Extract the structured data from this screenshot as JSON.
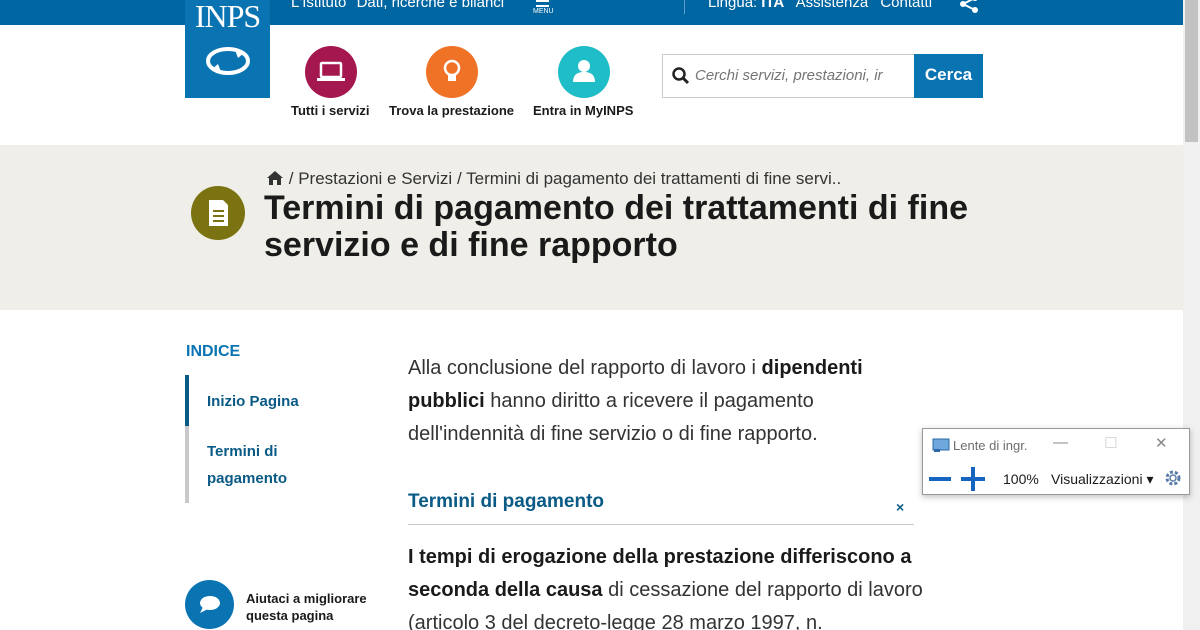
{
  "topbar": {
    "link_istituto": "L'Istituto",
    "link_dati": "Dati, ricerche e bilanci",
    "menu_label": "MENU",
    "lingua_label": "Lingua:",
    "lingua_value": "ITA",
    "link_assistenza": "Assistenza",
    "link_contatti": "Contatti"
  },
  "logo": {
    "text": "INPS"
  },
  "header": {
    "services": [
      {
        "label": "Tutti i servizi",
        "icon": "laptop-icon",
        "color": "#a4174f"
      },
      {
        "label": "Trova la prestazione",
        "icon": "lightbulb-icon",
        "color": "#f07227"
      },
      {
        "label": "Entra in MyINPS",
        "icon": "user-icon",
        "color": "#1ebdc8"
      }
    ],
    "search_placeholder": "Cerchi servizi, prestazioni, ir",
    "search_button": "Cerca"
  },
  "breadcrumb": {
    "separator": "/",
    "items": [
      "Prestazioni e Servizi",
      "Termini di pagamento dei trattamenti di fine servi.."
    ]
  },
  "page": {
    "title": "Termini di pagamento dei trattamenti di fine servizio e di fine rapporto",
    "badge_icon": "document-icon",
    "badge_color": "#7b7312"
  },
  "index": {
    "heading": "INDICE",
    "items": [
      "Inizio Pagina",
      "Termini di",
      "pagamento"
    ]
  },
  "feedback": {
    "line1": "Aiutaci a migliorare",
    "line2": "questa pagina"
  },
  "content": {
    "intro_1": "Alla conclusione del rapporto di lavoro i ",
    "intro_bold": "dipendenti pubblici",
    "intro_2": " hanno diritto a ricevere il pagamento dell'indennità di fine servizio o di fine rapporto.",
    "section_title": "Termini di pagamento",
    "section_close": "×",
    "body_bold": "I tempi di erogazione della prestazione differiscono a seconda della causa",
    "body_rest": " di cessazione del rapporto di lavoro (articolo 3 del decreto-legge 28 marzo 1997, n."
  },
  "magnifier": {
    "title": "Lente di ingr.",
    "minimize": "—",
    "maximize": "☐",
    "close": "✕",
    "zoom": "100%",
    "views": "Visualizzazioni ▾"
  }
}
